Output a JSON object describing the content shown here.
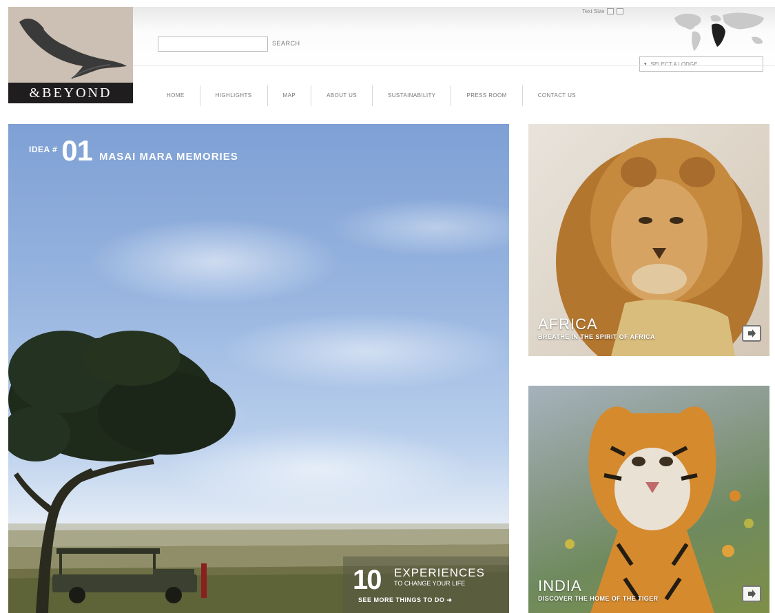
{
  "brand": {
    "logo_text": "&BEYOND"
  },
  "search": {
    "placeholder": "",
    "button_label": "SEARCH"
  },
  "text_size": {
    "label": "Text Size"
  },
  "lodge_select": {
    "selected": "SELECT A LODGE"
  },
  "nav": {
    "items": [
      {
        "label": "HOME"
      },
      {
        "label": "HIGHLIGHTS"
      },
      {
        "label": "MAP"
      },
      {
        "label": "ABOUT US"
      },
      {
        "label": "SUSTAINABILITY"
      },
      {
        "label": "PRESS ROOM"
      },
      {
        "label": "CONTACT US"
      }
    ]
  },
  "hero": {
    "idea_prefix": "IDEA #",
    "idea_number": "01",
    "idea_title": "MASAI MARA MEMORIES",
    "experiences_number": "10",
    "experiences_title": "EXPERIENCES",
    "experiences_subtitle": "TO CHANGE YOUR LIFE",
    "experiences_more": "SEE MORE THINGS TO DO"
  },
  "cards": [
    {
      "title": "AFRICA",
      "subtitle": "BREATHE IN THE SPIRIT OF AFRICA",
      "icon": "arrow-right-icon"
    },
    {
      "title": "INDIA",
      "subtitle": "DISCOVER THE HOME OF THE TIGER",
      "icon": "arrow-right-icon"
    }
  ],
  "colors": {
    "logo_bg": "#ccbfb3",
    "logo_band": "#1f1d1d",
    "sky": "#98b5e0",
    "text_gray": "#777777"
  }
}
